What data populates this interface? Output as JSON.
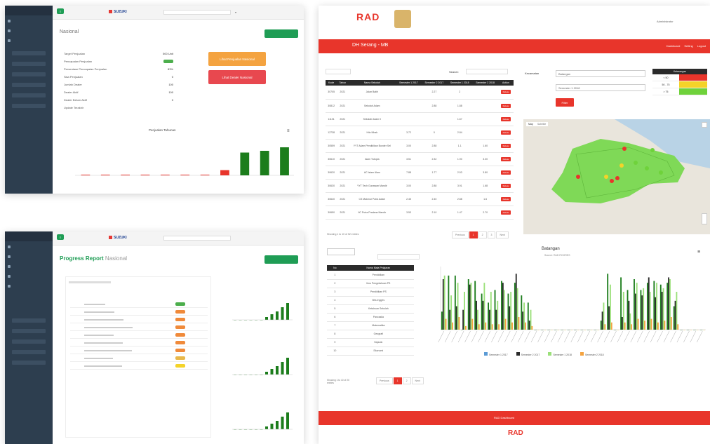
{
  "topleft": {
    "brand": "SUZUKI",
    "page_title": "Nasional",
    "summary_rows": [
      {
        "label": "Target Penjualan",
        "value": "500 Unit"
      },
      {
        "label": "Pencapaian Penjualan",
        "value": "",
        "badge": "pill-green"
      },
      {
        "label": "Persentase Pencapaian Penjualan",
        "value": "83%"
      },
      {
        "label": "Sisa Penjualan",
        "value": "0"
      },
      {
        "label": "Jumlah Dealer",
        "value": "100"
      },
      {
        "label": "Dealer Aktif",
        "value": "100"
      },
      {
        "label": "Dealer Belum Aktif",
        "value": "0"
      },
      {
        "label": "Update Terakhir",
        "value": ""
      }
    ],
    "orange_btn": "Lihat Penjualan Nasional",
    "pink_btn": "Lihat Dealer Nasional",
    "chart": {
      "title": "Penjualan Tahunan"
    }
  },
  "bottomleft": {
    "brand": "SUZUKI",
    "title": "Progress Report",
    "subtitle": "Nasional",
    "table_rows": 9
  },
  "right": {
    "logo": "RAD",
    "user_menu": "Administrator",
    "banner_title": "DH Serang - MB",
    "banner_links": [
      "Dashboard",
      "Setting",
      "Logout"
    ],
    "search_label": "Search:",
    "table_headers": [
      "Kode",
      "Tahun",
      "Nama Sekolah",
      "Semester 1 2017",
      "Semester 2 2017",
      "Semester 1 2018",
      "Semester 2 2018",
      "Action"
    ],
    "table_rows": [
      {
        "kode": "30705",
        "tahun": "2021",
        "nama": "Jalan Batiri",
        "s1": "",
        "s2": "2.27",
        "s3": "2",
        "s4": "",
        "act": "Delete"
      },
      {
        "kode": "30812",
        "tahun": "2021",
        "nama": "Sekolah Adam",
        "s1": "",
        "s2": "2.88",
        "s3": "1.88",
        "s4": "",
        "act": "Delete"
      },
      {
        "kode": "11101",
        "tahun": "2021",
        "nama": "Sekolah Adam II",
        "s1": "",
        "s2": "",
        "s3": "1.67",
        "s4": "",
        "act": "Delete"
      },
      {
        "kode": "12738",
        "tahun": "2021",
        "nama": "Hitz Mhab",
        "s1": "3.72",
        "s2": "0",
        "s3": "2.84",
        "s4": "",
        "act": "Delete"
      },
      {
        "kode": "30559",
        "tahun": "2021",
        "nama": "YYT Adam Pendidikan Bunder Sel",
        "s1": "3.00",
        "s2": "2.88",
        "s3": "1.1",
        "s4": "1.60",
        "act": "Delete"
      },
      {
        "kode": "30610",
        "tahun": "2021",
        "nama": "Alam Tutopia",
        "s1": "3.51",
        "s2": "2.32",
        "s3": "1.90",
        "s4": "3.30",
        "act": "Delete"
      },
      {
        "kode": "30620",
        "tahun": "2021",
        "nama": "AC Islam Alam",
        "s1": "7.88",
        "s2": "1.77",
        "s3": "2.53",
        "s4": "3.80",
        "act": "Delete"
      },
      {
        "kode": "30630",
        "tahun": "2021",
        "nama": "YYT Tech Gunawan Mandir",
        "s1": "3.00",
        "s2": "2.88",
        "s3": "3.91",
        "s4": "1.68",
        "act": "Delete"
      },
      {
        "kode": "30640",
        "tahun": "2021",
        "nama": "CS Makmur Putra Adam",
        "s1": "2.45",
        "s2": "2.40",
        "s3": "2.88",
        "s4": "1.6",
        "act": "Delete"
      },
      {
        "kode": "30650",
        "tahun": "2021",
        "nama": "IIC Putra Pradana Mandir",
        "s1": "3.53",
        "s2": "2.10",
        "s3": "1.47",
        "s4": "2.70",
        "act": "Delete"
      }
    ],
    "showing": "Showing 1 to 10 of 52 entries",
    "pager": [
      "Previous",
      "1",
      "2",
      "3",
      "Next"
    ],
    "filter_label": "Kecamatan",
    "filter1": "Batangan",
    "filter2": "Semester 1 2018",
    "filter_btn": "Filter",
    "legend_title": "Keterangan",
    "legend": [
      {
        "label": "< 50",
        "color": "#e8352b"
      },
      {
        "label": "50 - 75",
        "color": "#f4d329"
      },
      {
        "label": "> 75",
        "color": "#6fd23b"
      }
    ],
    "map_tabs": [
      "Map",
      "Satellite"
    ],
    "small_table_headers": [
      "No",
      "Nama Mata Pelajaran"
    ],
    "small_table_rows": [
      "Pendidikan",
      "Ilmu Pengetahuan PS",
      "Pendidikan PS",
      "Bhs Inggris",
      "Ketahuan Sekolah",
      "Pancasila",
      "Matematika",
      "Geografi",
      "Sejarah",
      "Ekonomi"
    ],
    "small_pager": [
      "Previous",
      "1",
      "2",
      "Next"
    ],
    "small_showing": "Showing 1 to 10 of 20 entries",
    "chart_title": "Batangan",
    "chart_subtitle": "Source: RAD ROGRES",
    "chart_legend": [
      "Semester 1 2017",
      "Semester 2 2017",
      "Semester 1 2018",
      "Semester 2 2018"
    ],
    "footer": "RAD Dashboard",
    "footer_logo": "RAD"
  },
  "chart_data": [
    {
      "type": "bar",
      "categories": [
        "1",
        "2",
        "3",
        "4",
        "5",
        "6",
        "7",
        "8",
        "9",
        "10",
        "11"
      ],
      "series": [
        {
          "values": [
            0,
            0,
            0,
            0,
            0,
            0,
            0,
            3,
            13,
            14,
            16
          ]
        }
      ],
      "ylim": [
        0,
        20
      ]
    },
    {
      "type": "bar",
      "title": "Batangan",
      "categories": [
        "a1",
        "a2",
        "a3",
        "a4",
        "a5",
        "a6",
        "a7",
        "a8",
        "a9",
        "a10",
        "a11",
        "a12",
        "a13",
        "a14",
        "a15",
        "a16",
        "a17",
        "a18",
        "a19",
        "a20",
        "a21",
        "a22",
        "a23",
        "a24",
        "a25",
        "a26",
        "a27",
        "a28",
        "a29",
        "a30",
        "a31",
        "a32",
        "a33",
        "a34",
        "a35",
        "a36",
        "a37",
        "a38",
        "a39",
        "a40"
      ],
      "series": [
        {
          "name": "Semester 1 2017",
          "values": [
            1,
            3,
            3,
            0,
            2.8,
            2.7,
            2,
            1.5,
            2.2,
            2.7,
            2,
            2.6,
            1.9,
            1.5,
            0,
            0,
            0,
            0,
            0,
            0,
            0,
            0,
            0,
            0,
            0.5,
            3.1,
            0,
            2.9,
            2.2,
            2.8,
            2.2,
            2.6,
            2.7,
            2.5,
            2.6,
            1.3,
            0,
            0,
            0,
            0
          ]
        },
        {
          "name": "Semester 2 2017",
          "values": [
            2.8,
            1.1,
            1.3,
            1.1,
            2.5,
            1.6,
            1.6,
            1.1,
            1.1,
            2.6,
            1.3,
            3.1,
            1,
            0.5,
            0,
            0,
            0,
            0,
            0,
            0,
            0,
            0,
            0,
            0,
            1,
            1.3,
            0,
            0.7,
            1.6,
            2,
            1.9,
            2.9,
            1.8,
            2.1,
            2.9,
            1.6,
            0,
            0,
            0,
            0
          ]
        },
        {
          "name": "Semester 1 2018",
          "values": [
            3,
            1.9,
            2.6,
            2.1,
            2.6,
            1.1,
            2.6,
            2.1,
            1.6,
            2.2,
            2.1,
            2.3,
            1.5,
            1.1,
            0,
            0,
            0,
            0,
            0,
            0,
            0,
            0,
            0,
            0,
            1.5,
            2.5,
            0,
            2.1,
            0.9,
            2.6,
            2.3,
            2.1,
            2.6,
            2.3,
            2.8,
            2.1,
            0,
            0,
            0,
            0
          ]
        },
        {
          "name": "Semester 2 2018",
          "values": [
            0.6,
            0.4,
            0.7,
            0.2,
            0.6,
            0.3,
            0.4,
            0.3,
            0.3,
            0.6,
            0.4,
            0.7,
            0.4,
            0.2,
            0,
            0,
            0,
            0,
            0,
            0,
            0,
            0,
            0,
            0,
            0.3,
            0.4,
            0,
            0.4,
            0.3,
            0.6,
            0.5,
            0.6,
            0.4,
            0.5,
            0.7,
            0.3,
            0,
            0,
            0,
            0
          ]
        }
      ]
    }
  ]
}
